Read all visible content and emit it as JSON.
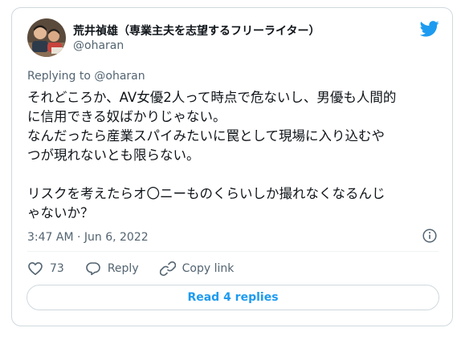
{
  "author": {
    "display_name": "荒井禎雄（専業主夫を志望するフリーライター）",
    "handle": "@oharan",
    "avatar_icon": "user-avatar"
  },
  "reply_context": {
    "prefix": "Replying to ",
    "mention": "@oharan"
  },
  "tweet": {
    "lines": [
      "それどころか、AV女優2人って時点で危ないし、男優も人間的",
      "に信用できる奴ばかりじゃない。",
      "なんだったら産業スパイみたいに罠として現場に入り込むや",
      "つが現れないとも限らない。",
      "",
      "リスクを考えたらオ〇ニーものくらいしか撮れなくなるんじ",
      "ゃないか？"
    ],
    "timestamp": "3:47 AM · Jun 6, 2022"
  },
  "actions": {
    "like_count": "73",
    "reply_label": "Reply",
    "copy_link_label": "Copy link"
  },
  "read_replies_label": "Read 4 replies",
  "colors": {
    "accent": "#1d9bf0",
    "text": "#0f1419",
    "secondary": "#536471",
    "border": "#cfd9de"
  }
}
